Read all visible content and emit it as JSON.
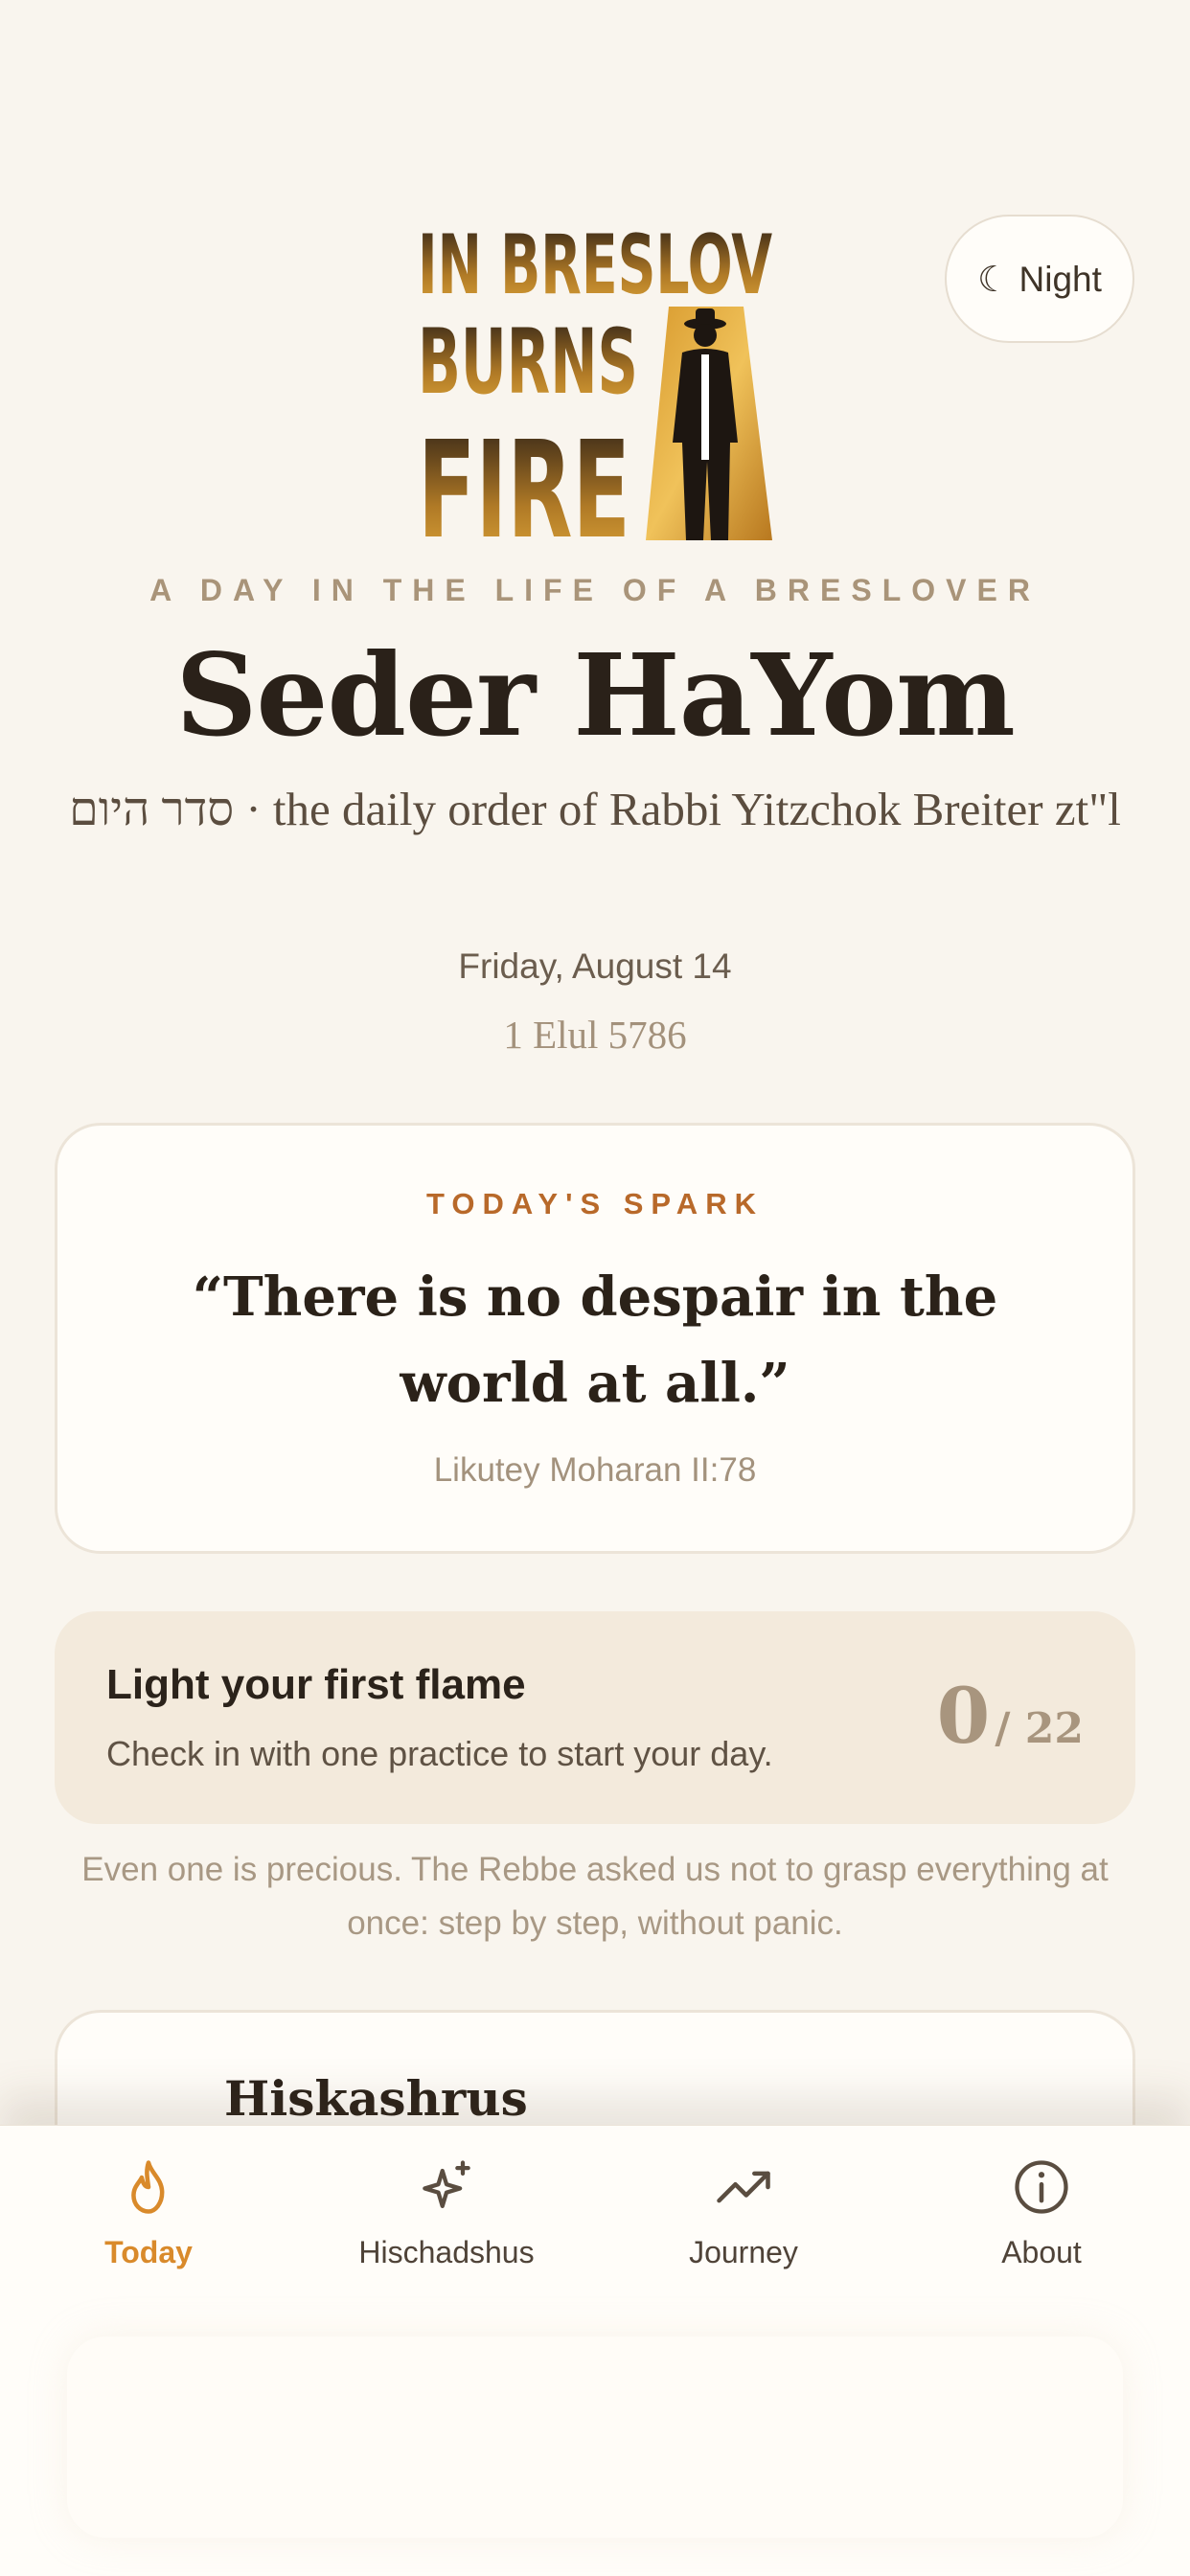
{
  "header": {
    "night_toggle_label": "☾ Night",
    "logo_lines": [
      "IN BRESLOV",
      "BURNS",
      "FIRE"
    ],
    "eyebrow": "A DAY IN THE LIFE OF A BRESLOVER",
    "title": "Seder HaYom",
    "subtitle": "סדר היום · the daily order of Rabbi Yitzchok Breiter zt\"l",
    "date": "Friday, August 14",
    "hebrew_date": "1 Elul 5786"
  },
  "spark": {
    "label": "TODAY'S SPARK",
    "quote": "“There is no despair in the world at all.”",
    "source": "Likutey Moharan II:78"
  },
  "progress": {
    "title": "Light your first flame",
    "subtitle": "Check in with one practice to start your day.",
    "count": "0",
    "total": "/ 22",
    "note": "Even one is precious. The Rebbe asked us not to grasp everything at once: step by step, without panic."
  },
  "practice": {
    "title": "Hiskashrus"
  },
  "tabs": [
    {
      "label": "Today",
      "icon": "flame-icon",
      "active": true
    },
    {
      "label": "Hischadshus",
      "icon": "sparkle-icon",
      "active": false
    },
    {
      "label": "Journey",
      "icon": "trending-up-icon",
      "active": false
    },
    {
      "label": "About",
      "icon": "info-icon",
      "active": false
    }
  ],
  "colors": {
    "background": "#f9f5ee",
    "accent": "#d98a2b",
    "spark_label": "#b8692a",
    "card": "#fffdf9",
    "progress_card": "#f3eadc"
  }
}
